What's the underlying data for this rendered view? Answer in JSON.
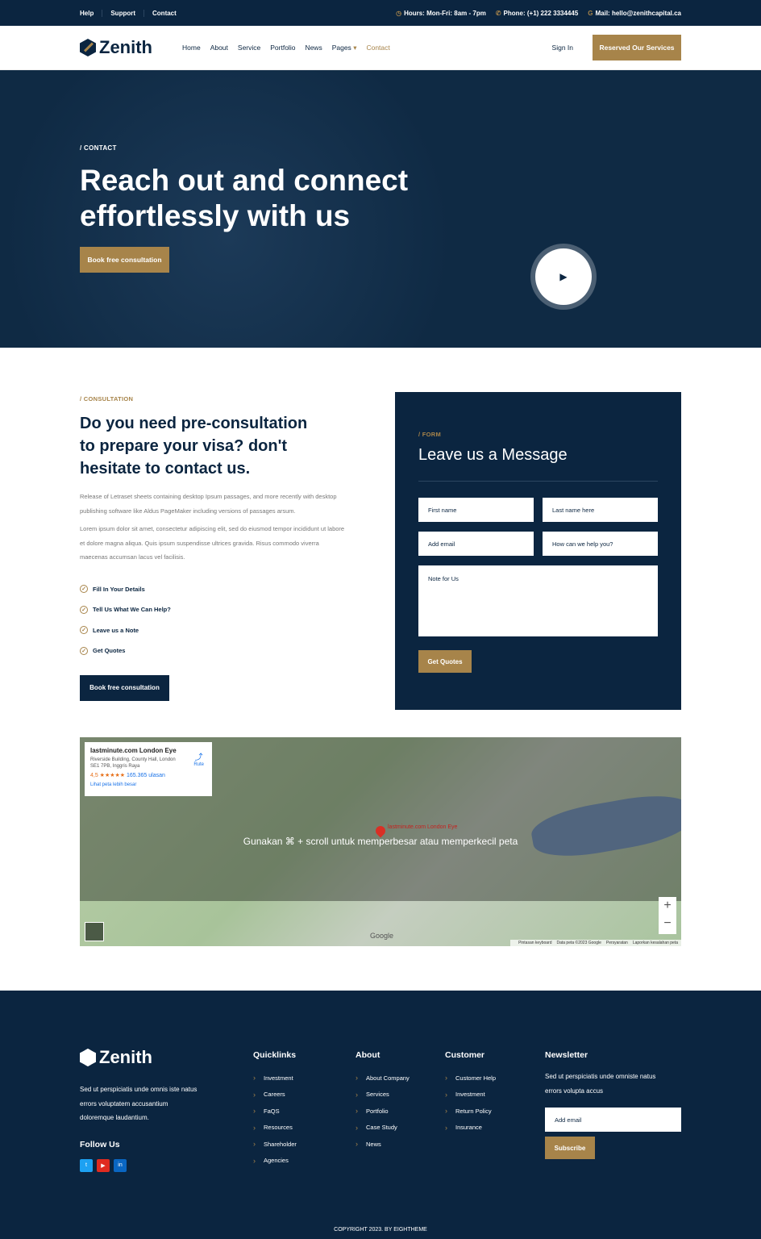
{
  "topbar": {
    "links": [
      "Help",
      "Support",
      "Contact"
    ],
    "hours": "Hours: Mon-Fri: 8am - 7pm",
    "phone": "Phone: (+1) 222 3334445",
    "mail": "Mail: hello@zenithcapital.ca"
  },
  "nav": {
    "brand": "Zenith",
    "items": [
      "Home",
      "About",
      "Service",
      "Portfolio",
      "News",
      "Pages",
      "Contact"
    ],
    "active": "Contact",
    "sign_in": "Sign In",
    "cta": "Reserved Our Services"
  },
  "hero": {
    "crumb": "/ CONTACT",
    "title": "Reach out and connect effortlessly with us",
    "cta": "Book free consultation"
  },
  "consultation": {
    "tag": "/ CONSULTATION",
    "title": "Do you need pre-consultation to prepare your visa? don't hesitate to contact us.",
    "p1": "Release of Letraset sheets containing desktop Ipsum passages, and more recently with desktop publishing software like Aldus PageMaker including versions of passages arsum.",
    "p2": "Lorem ipsum dolor sit amet, consectetur adipiscing elit, sed do eiusmod tempor incididunt ut labore et dolore magna aliqua. Quis ipsum suspendisse ultrices gravida. Risus commodo viverra maecenas accumsan lacus vel facilisis.",
    "checks": [
      "Fill In Your Details",
      "Tell Us What We Can Help?",
      "Leave us a Note",
      "Get Quotes"
    ],
    "cta": "Book free consultation"
  },
  "form": {
    "tag": "/ FORM",
    "title": "Leave us a Message",
    "first_name": "First name",
    "last_name": "Last name here",
    "email": "Add email",
    "help": "How can we help you?",
    "note": "Note for Us",
    "submit": "Get Quotes"
  },
  "map": {
    "place": "lastminute.com London Eye",
    "address": "Riverside Building, County Hall, London SE1 7PB, Inggris Raya",
    "rating": "4,5 ★★★★★",
    "reviews": "165.365 ulasan",
    "route": "Rute",
    "larger": "Lihat peta lebih besar",
    "overlay": "Gunakan ⌘ + scroll untuk memperbesar atau memperkecil peta",
    "pin_label": "lastminute.com London Eye",
    "google": "Google",
    "attribution": [
      "Pintasan keyboard",
      "Data peta ©2023 Google",
      "Persyaratan",
      "Laporkan kesalahan peta"
    ]
  },
  "footer": {
    "brand": "Zenith",
    "about": "Sed ut perspiciatis unde omnis iste natus errors voluptatem accusantium doloremque laudantium.",
    "follow": "Follow Us",
    "quicklinks": {
      "title": "Quicklinks",
      "items": [
        "Investment",
        "Careers",
        "FaQS",
        "Resources",
        "Shareholder",
        "Agencies"
      ]
    },
    "about_col": {
      "title": "About",
      "items": [
        "About Company",
        "Services",
        "Portfolio",
        "Case Study",
        "News"
      ]
    },
    "customer": {
      "title": "Customer",
      "items": [
        "Customer Help",
        "Investment",
        "Return Policy",
        "Insurance"
      ]
    },
    "newsletter": {
      "title": "Newsletter",
      "text": "Sed ut perspiciatis unde omniste natus errors volupta accus",
      "placeholder": "Add email",
      "button": "Subscribe"
    },
    "copyright": "COPYRIGHT 2023. BY EIGHTHEME"
  },
  "colors": {
    "navy": "#0b2540",
    "gold": "#a7844a"
  }
}
